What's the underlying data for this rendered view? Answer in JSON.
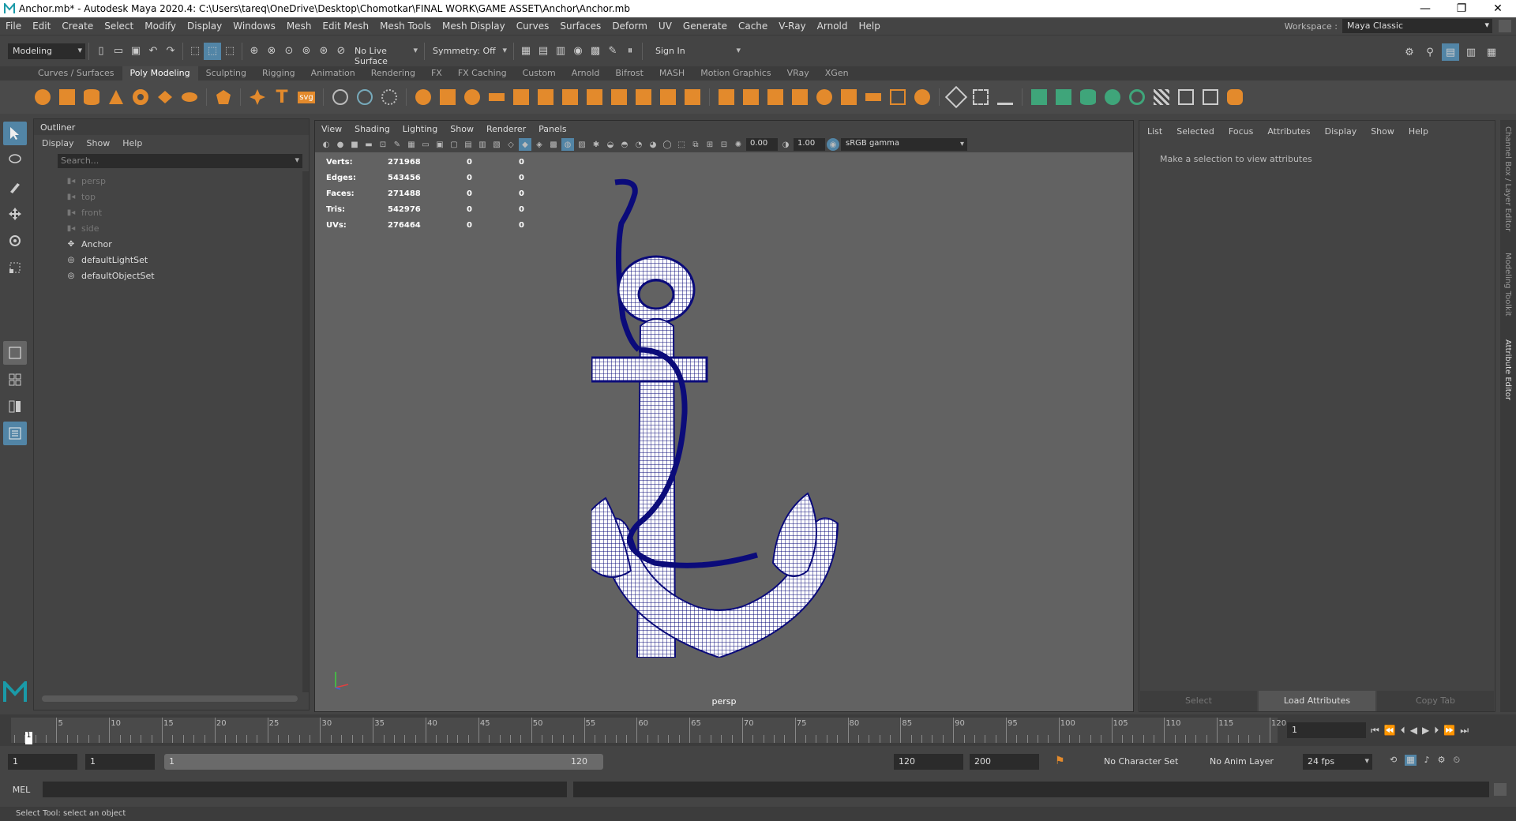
{
  "titlebar": {
    "title": "Anchor.mb* - Autodesk Maya 2020.4: C:\\Users\\tareq\\OneDrive\\Desktop\\Chomotkar\\FINAL WORK\\GAME ASSET\\Anchor\\Anchor.mb",
    "minimize": "—",
    "restore": "❐",
    "close": "✕"
  },
  "menubar": {
    "items": [
      "File",
      "Edit",
      "Create",
      "Select",
      "Modify",
      "Display",
      "Windows",
      "Mesh",
      "Edit Mesh",
      "Mesh Tools",
      "Mesh Display",
      "Curves",
      "Surfaces",
      "Deform",
      "UV",
      "Generate",
      "Cache",
      "V-Ray",
      "Arnold",
      "Help"
    ],
    "workspace_label": "Workspace :",
    "workspace_value": "Maya Classic"
  },
  "statusline": {
    "mode": "Modeling",
    "live_surface": "No Live Surface",
    "symmetry": "Symmetry: Off",
    "sign_in": "Sign In"
  },
  "shelf": {
    "tabs": [
      "Curves / Surfaces",
      "Poly Modeling",
      "Sculpting",
      "Rigging",
      "Animation",
      "Rendering",
      "FX",
      "FX Caching",
      "Custom",
      "Arnold",
      "Bifrost",
      "MASH",
      "Motion Graphics",
      "VRay",
      "XGen"
    ],
    "active_tab": "Poly Modeling",
    "text_tool": "T",
    "svg_tool": "svg"
  },
  "outliner": {
    "title": "Outliner",
    "menu": [
      "Display",
      "Show",
      "Help"
    ],
    "search_placeholder": "Search...",
    "items": [
      {
        "label": "persp",
        "icon": "camera-icon",
        "dim": true
      },
      {
        "label": "top",
        "icon": "camera-icon",
        "dim": true
      },
      {
        "label": "front",
        "icon": "camera-icon",
        "dim": true
      },
      {
        "label": "side",
        "icon": "camera-icon",
        "dim": true
      },
      {
        "label": "Anchor",
        "icon": "transform-icon",
        "dim": false
      },
      {
        "label": "defaultLightSet",
        "icon": "set-icon",
        "dim": false
      },
      {
        "label": "defaultObjectSet",
        "icon": "set-icon",
        "dim": false
      }
    ]
  },
  "viewport": {
    "menu": [
      "View",
      "Shading",
      "Lighting",
      "Show",
      "Renderer",
      "Panels"
    ],
    "exposure": "0.00",
    "gamma": "1.00",
    "color_space": "sRGB gamma",
    "hud": [
      {
        "label": "Verts:",
        "v1": "271968",
        "v2": "0",
        "v3": "0"
      },
      {
        "label": "Edges:",
        "v1": "543456",
        "v2": "0",
        "v3": "0"
      },
      {
        "label": "Faces:",
        "v1": "271488",
        "v2": "0",
        "v3": "0"
      },
      {
        "label": "Tris:",
        "v1": "542976",
        "v2": "0",
        "v3": "0"
      },
      {
        "label": "UVs:",
        "v1": "276464",
        "v2": "0",
        "v3": "0"
      }
    ],
    "camera": "persp",
    "wire_color": "#0b0b7a"
  },
  "attribute_editor": {
    "menu": [
      "List",
      "Selected",
      "Focus",
      "Attributes",
      "Display",
      "Show",
      "Help"
    ],
    "message": "Make a selection to view attributes",
    "buttons": [
      "Select",
      "Load Attributes",
      "Copy Tab"
    ],
    "side_tabs": [
      "Channel Box / Layer Editor",
      "Modeling Toolkit",
      "Attribute Editor"
    ]
  },
  "timeline": {
    "ticks": [
      "5",
      "10",
      "15",
      "20",
      "25",
      "30",
      "35",
      "40",
      "45",
      "50",
      "55",
      "60",
      "65",
      "70",
      "75",
      "80",
      "85",
      "90",
      "95",
      "100",
      "105",
      "110",
      "115",
      "120"
    ],
    "current_marker": "1",
    "current_frame": "1"
  },
  "range": {
    "start": "1",
    "playback_start": "1",
    "slider_start": "1",
    "slider_end": "120",
    "playback_end": "120",
    "end": "200",
    "character_set": "No Character Set",
    "anim_layer": "No Anim Layer",
    "fps": "24 fps"
  },
  "cmdline": {
    "label": "MEL"
  },
  "helpline": {
    "text": "Select Tool: select an object"
  },
  "colors": {
    "accent": "#5285a6",
    "shelf_icon": "#e38a2c",
    "shelf_icon_green": "#3fa57a"
  }
}
